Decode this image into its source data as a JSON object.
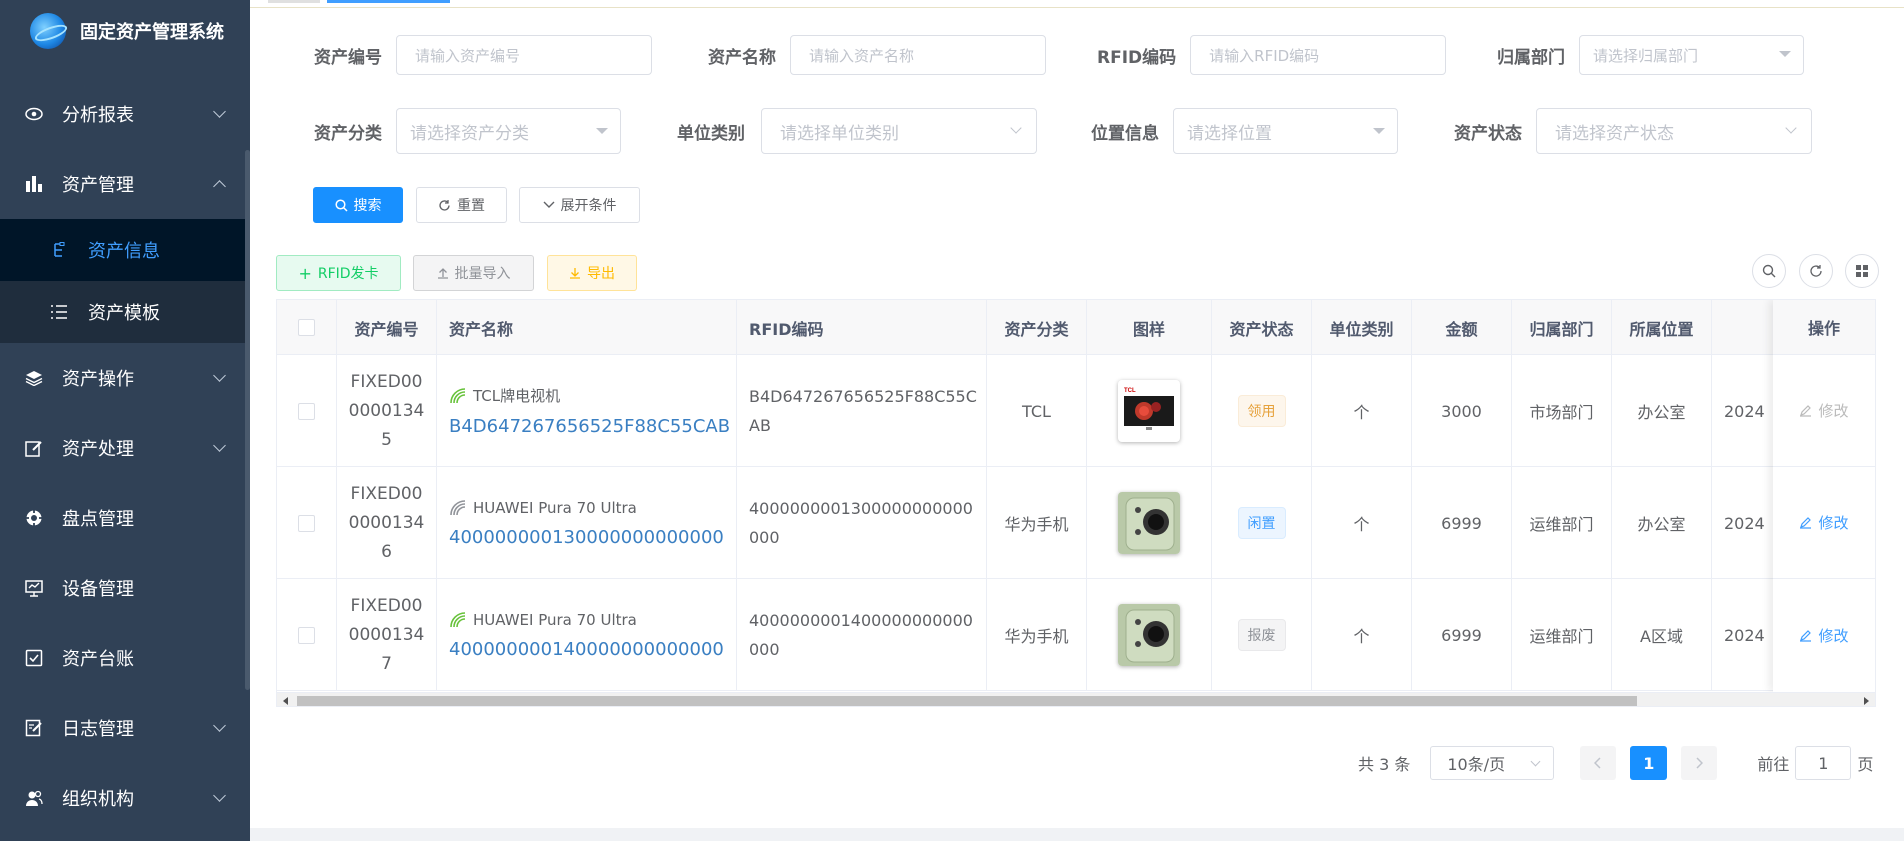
{
  "app": {
    "title": "固定资产管理系统"
  },
  "sidebar": {
    "items": [
      {
        "label": "分析报表",
        "icon": "eye-icon",
        "expandable": true
      },
      {
        "label": "资产管理",
        "icon": "bar-chart-icon",
        "expandable": true,
        "expanded": true,
        "children": [
          {
            "label": "资产信息",
            "icon": "tree-icon",
            "active": true
          },
          {
            "label": "资产模板",
            "icon": "list-icon"
          }
        ]
      },
      {
        "label": "资产操作",
        "icon": "layers-icon",
        "expandable": true
      },
      {
        "label": "资产处理",
        "icon": "edit-icon",
        "expandable": true
      },
      {
        "label": "盘点管理",
        "icon": "target-icon"
      },
      {
        "label": "设备管理",
        "icon": "monitor-icon"
      },
      {
        "label": "资产台账",
        "icon": "checkbox-icon"
      },
      {
        "label": "日志管理",
        "icon": "form-icon",
        "expandable": true
      },
      {
        "label": "组织机构",
        "icon": "peoples-icon",
        "expandable": true
      }
    ]
  },
  "filters": {
    "asset_no": {
      "label": "资产编号",
      "placeholder": "请输入资产编号"
    },
    "asset_name": {
      "label": "资产名称",
      "placeholder": "请输入资产名称"
    },
    "rfid": {
      "label": "RFID编码",
      "placeholder": "请输入RFID编码"
    },
    "dept": {
      "label": "归属部门",
      "placeholder": "请选择归属部门"
    },
    "category": {
      "label": "资产分类",
      "placeholder": "请选择资产分类"
    },
    "unit": {
      "label": "单位类别",
      "placeholder": "请选择单位类别"
    },
    "location": {
      "label": "位置信息",
      "placeholder": "请选择位置"
    },
    "status": {
      "label": "资产状态",
      "placeholder": "请选择资产状态"
    }
  },
  "buttons": {
    "search": "搜索",
    "reset": "重置",
    "expand": "展开条件",
    "rfid_card": "RFID发卡",
    "batch_import": "批量导入",
    "export": "导出"
  },
  "table": {
    "headers": [
      "资产编号",
      "资产名称",
      "RFID编码",
      "资产分类",
      "图样",
      "资产状态",
      "单位类别",
      "金额",
      "归属部门",
      "所属位置",
      "",
      "操作"
    ],
    "rows": [
      {
        "asset_no": "FIXED000000134 5",
        "name": "TCL牌电视机",
        "code": "B4D647267656525F88C55CAB",
        "rfid": "B4D647267656525F88C55CAB",
        "category": "TCL",
        "image": "tv-thumbnail",
        "status": "领用",
        "status_type": "warn",
        "unit": "个",
        "amount": "3000",
        "dept": "市场部门",
        "location": "办公室",
        "date": "2024",
        "op": "修改",
        "op_disabled": true,
        "rfid_icon_color": "#67c23a"
      },
      {
        "asset_no": "FIXED000000134 6",
        "name": "HUAWEI Pura 70 Ultra",
        "code": "400000000130000000000000",
        "rfid": "4000000001300000000000000",
        "category": "华为手机",
        "image": "phone-thumbnail",
        "status": "闲置",
        "status_type": "info",
        "unit": "个",
        "amount": "6999",
        "dept": "运维部门",
        "location": "办公室",
        "date": "2024",
        "op": "修改",
        "op_disabled": false,
        "rfid_icon_color": "#909399"
      },
      {
        "asset_no": "FIXED000000134 7",
        "name": "HUAWEI Pura 70 Ultra",
        "code": "400000000140000000000000",
        "rfid": "4000000001400000000000000",
        "category": "华为手机",
        "image": "phone-thumbnail",
        "status": "报废",
        "status_type": "gray",
        "unit": "个",
        "amount": "6999",
        "dept": "运维部门",
        "location": "A区域",
        "date": "2024",
        "op": "修改",
        "op_disabled": false,
        "rfid_icon_color": "#67c23a"
      }
    ]
  },
  "pagination": {
    "total_text": "共 3 条",
    "page_size": "10条/页",
    "current_page": "1",
    "goto_label": "前往",
    "goto_value": "1",
    "page_unit": "页"
  },
  "colors": {
    "sidebar_bg": "#304156",
    "primary": "#1890ff",
    "active_text": "#409eff"
  }
}
